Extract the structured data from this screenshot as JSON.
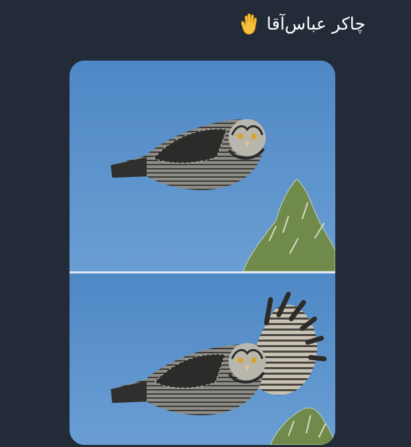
{
  "post": {
    "caption": "چاکر عباس‌آقا",
    "caption_emoji": "raised-hand-icon"
  },
  "colors": {
    "background": "#222b37",
    "sky": "#5c90c9",
    "text": "#ffffff"
  }
}
